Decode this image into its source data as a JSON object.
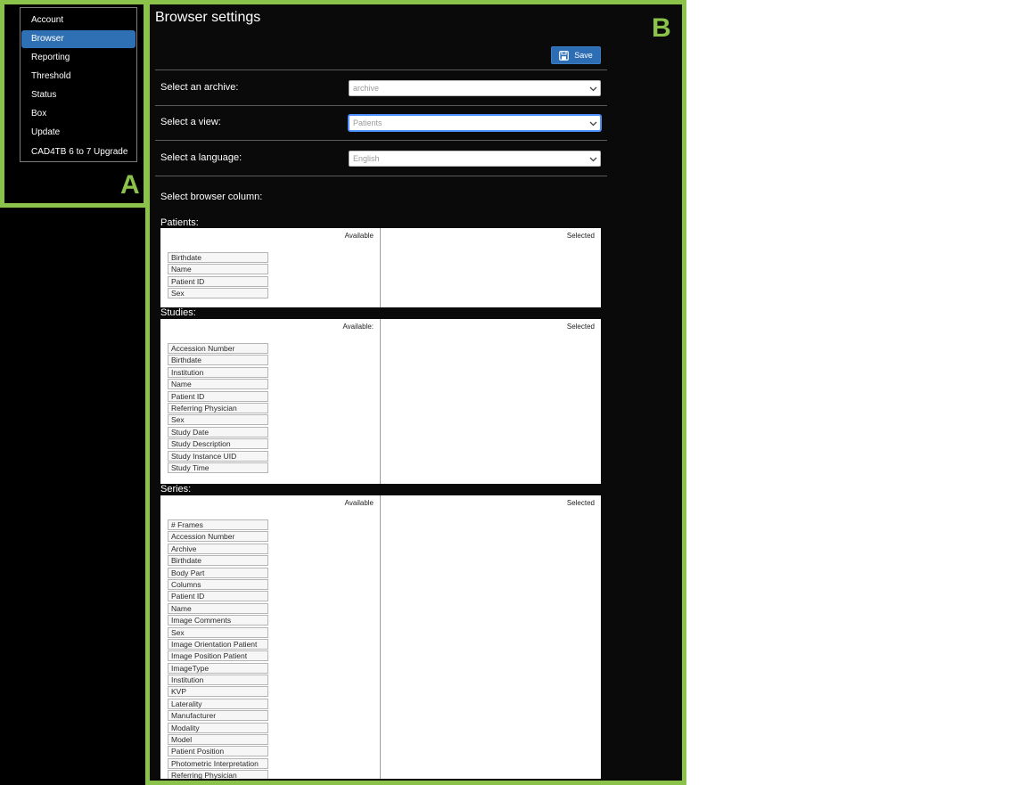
{
  "annotations": {
    "panel_a": "A",
    "panel_b": "B"
  },
  "colors": {
    "accent": "#2f6fb3",
    "frame": "#8bc34a",
    "background": "#0a0a0a"
  },
  "sidebar": {
    "items": [
      {
        "label": "Account",
        "active": false
      },
      {
        "label": "Browser",
        "active": true
      },
      {
        "label": "Reporting",
        "active": false
      },
      {
        "label": "Threshold",
        "active": false
      },
      {
        "label": "Status",
        "active": false
      },
      {
        "label": "Box",
        "active": false
      },
      {
        "label": "Update",
        "active": false
      },
      {
        "label": "CAD4TB 6 to 7 Upgrade",
        "active": false
      }
    ]
  },
  "main": {
    "title": "Browser settings",
    "save_label": "Save",
    "save_icon": "floppy-disk-icon",
    "settings": [
      {
        "label": "Select an archive:",
        "value": "archive"
      },
      {
        "label": "Select a view:",
        "value": "Patients"
      },
      {
        "label": "Select a language:",
        "value": "English"
      }
    ],
    "columns_heading": "Select browser column:",
    "panels": [
      {
        "heading": "Patients:",
        "available_caption": "Available",
        "selected_caption": "Selected",
        "available": [
          "Birthdate",
          "Name",
          "Patient ID",
          "Sex"
        ],
        "selected": []
      },
      {
        "heading": "Studies:",
        "available_caption": "Available:",
        "selected_caption": "Selected",
        "available": [
          "Accession Number",
          "Birthdate",
          "Institution",
          "Name",
          "Patient ID",
          "Referring Physician",
          "Sex",
          "Study Date",
          "Study Description",
          "Study Instance UID",
          "Study Time"
        ],
        "selected": []
      },
      {
        "heading": "Series:",
        "available_caption": "Available",
        "selected_caption": "Selected",
        "available": [
          "# Frames",
          "Accession Number",
          "Archive",
          "Birthdate",
          "Body Part",
          "Columns",
          "Patient ID",
          "Name",
          "Image Comments",
          "Sex",
          "Image Orientation Patient",
          "Image Position Patient",
          "ImageType",
          "Institution",
          "KVP",
          "Laterality",
          "Manufacturer",
          "Modality",
          "Model",
          "Patient Position",
          "Photometric Interpretation",
          "Referring Physician"
        ],
        "selected": []
      }
    ]
  }
}
